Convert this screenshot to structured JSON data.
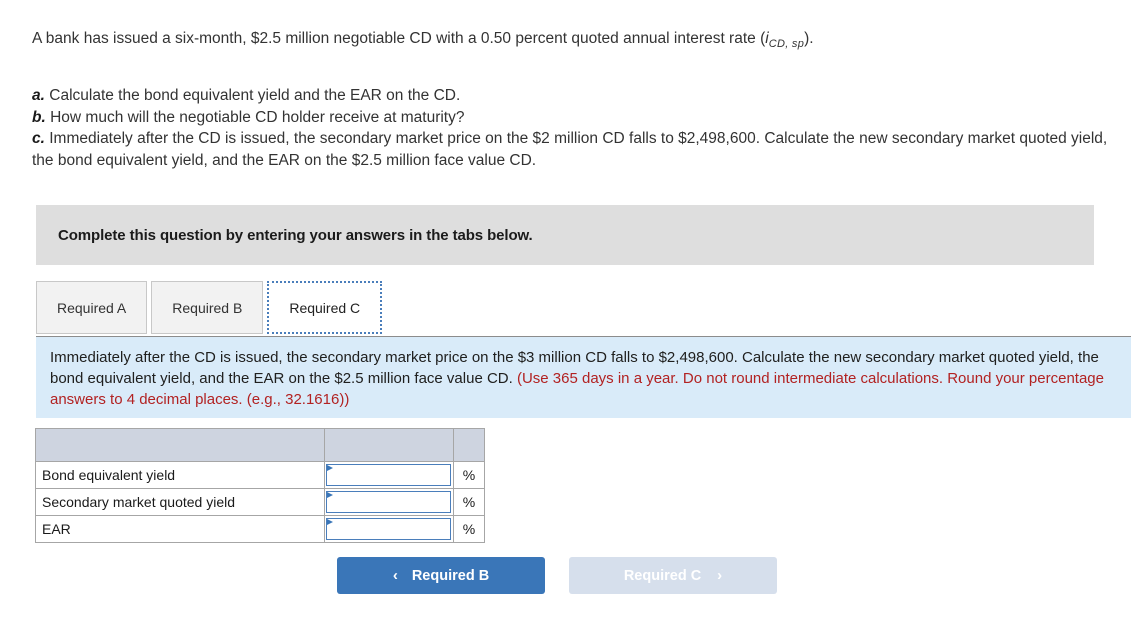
{
  "question": {
    "stem_before": "A bank has issued a six-month, $2.5 million negotiable CD with a 0.50 percent quoted annual interest rate (",
    "stem_symbol": "i",
    "stem_subscript": "CD, sp",
    "stem_after": ").",
    "parts": [
      {
        "mark": "a.",
        "text": "Calculate the bond equivalent yield and the EAR on the CD."
      },
      {
        "mark": "b.",
        "text": "How much will the negotiable CD holder receive at maturity?"
      },
      {
        "mark": "c.",
        "text": "Immediately after the CD is issued, the secondary market price on the $2 million CD falls to $2,498,600. Calculate the new secondary market quoted yield, the bond equivalent yield, and the EAR on the $2.5 million face value CD."
      }
    ]
  },
  "banner": {
    "text": "Complete this question by entering your answers in the tabs below."
  },
  "tabs": [
    {
      "label": "Required A",
      "active": false
    },
    {
      "label": "Required B",
      "active": false
    },
    {
      "label": "Required C",
      "active": true
    }
  ],
  "instruction": {
    "black_text": "Immediately after the CD is issued, the secondary market price on the $3 million CD falls to $2,498,600. Calculate the new secondary market quoted yield, the bond equivalent yield, and the EAR on the $2.5 million face value CD. ",
    "red_text": "(Use 365 days in a year. Do not round intermediate calculations. Round your percentage answers to 4 decimal places. (e.g., 32.1616))",
    "background_color": "#d9ebf9",
    "red_color": "#b22222"
  },
  "answer_table": {
    "header": {
      "label_col": "",
      "value_col": "",
      "unit_col": ""
    },
    "rows": [
      {
        "label": "Bond equivalent yield",
        "value": "",
        "placeholder": "",
        "unit": "%"
      },
      {
        "label": "Secondary market quoted yield",
        "value": "",
        "placeholder": "",
        "unit": "%"
      },
      {
        "label": "EAR",
        "value": "",
        "placeholder": "",
        "unit": "%"
      }
    ],
    "header_color": "#ced4e0",
    "input_border_color": "#4a7ebb"
  },
  "navigation": {
    "prev_label": "Required B",
    "prev_icon": "chevron-left",
    "prev_glyph": "‹",
    "next_label": "Required C",
    "next_icon": "chevron-right",
    "next_glyph": "›",
    "prev_color": "#3a76b8",
    "next_color": "#d6dfec",
    "next_disabled": true
  }
}
